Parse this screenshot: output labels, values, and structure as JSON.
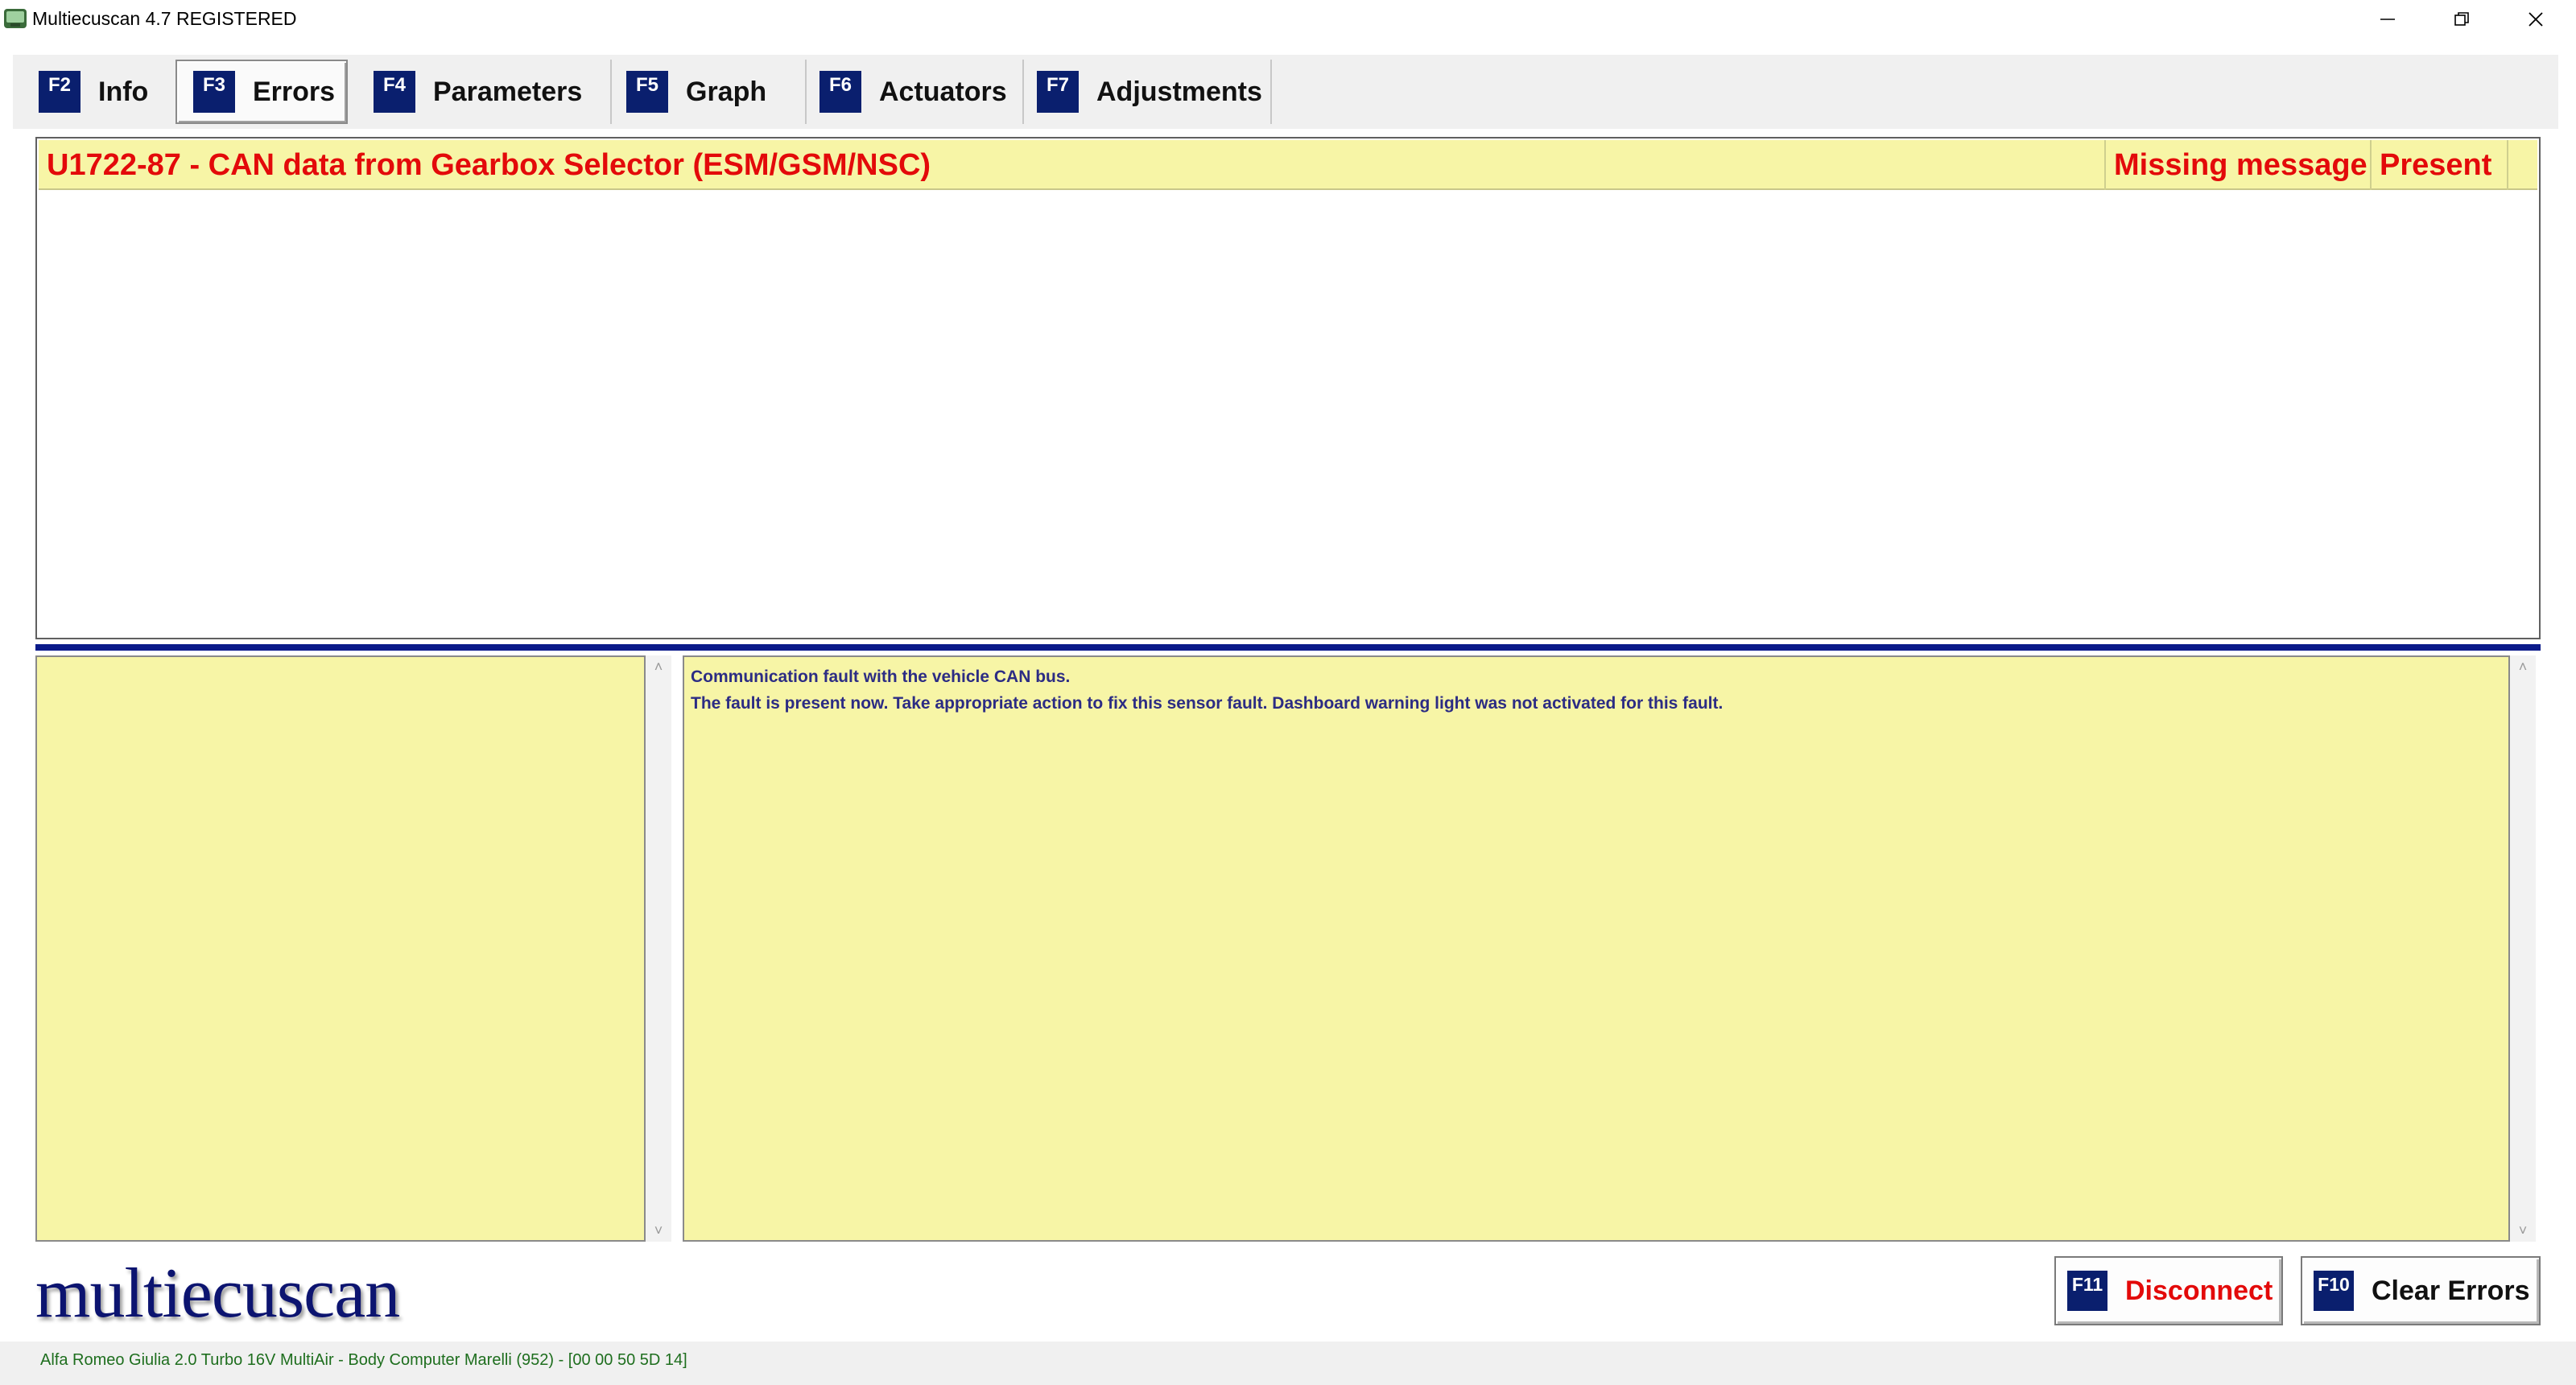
{
  "window": {
    "title": "Multiecuscan 4.7 REGISTERED",
    "app_icon": "multiecuscan-app-icon",
    "controls": [
      "minimize-icon",
      "restore-icon",
      "close-icon"
    ]
  },
  "tabs": [
    {
      "key": "F2",
      "label": "Info",
      "active": false
    },
    {
      "key": "F3",
      "label": "Errors",
      "active": true
    },
    {
      "key": "F4",
      "label": "Parameters",
      "active": false
    },
    {
      "key": "F5",
      "label": "Graph",
      "active": false
    },
    {
      "key": "F6",
      "label": "Actuators",
      "active": false
    },
    {
      "key": "F7",
      "label": "Adjustments",
      "active": false
    }
  ],
  "errors": [
    {
      "code_description": "U1722-87 - CAN data from Gearbox Selector (ESM/GSM/NSC)",
      "type": "Missing message",
      "status": "Present"
    }
  ],
  "description": {
    "lines": [
      "Communication fault with the vehicle CAN bus.",
      "The fault is present now. Take appropriate action to fix this sensor fault. Dashboard warning light was not activated for this fault."
    ]
  },
  "logo": "multiecuscan",
  "buttons": {
    "disconnect": {
      "key": "F11",
      "label": "Disconnect",
      "color": "#e30a0a"
    },
    "clear_errors": {
      "key": "F10",
      "label": "Clear Errors",
      "color": "#111111"
    }
  },
  "status_bar": "Alfa Romeo Giulia 2.0 Turbo 16V MultiAir - Body Computer Marelli (952) - [00 00 50 5D 14]",
  "colors": {
    "accent_navy": "#0a1f6e",
    "error_red": "#e30a0a",
    "panel_yellow": "#f7f5a6",
    "description_text": "#2c2c84",
    "status_green": "#1e6e1e"
  }
}
